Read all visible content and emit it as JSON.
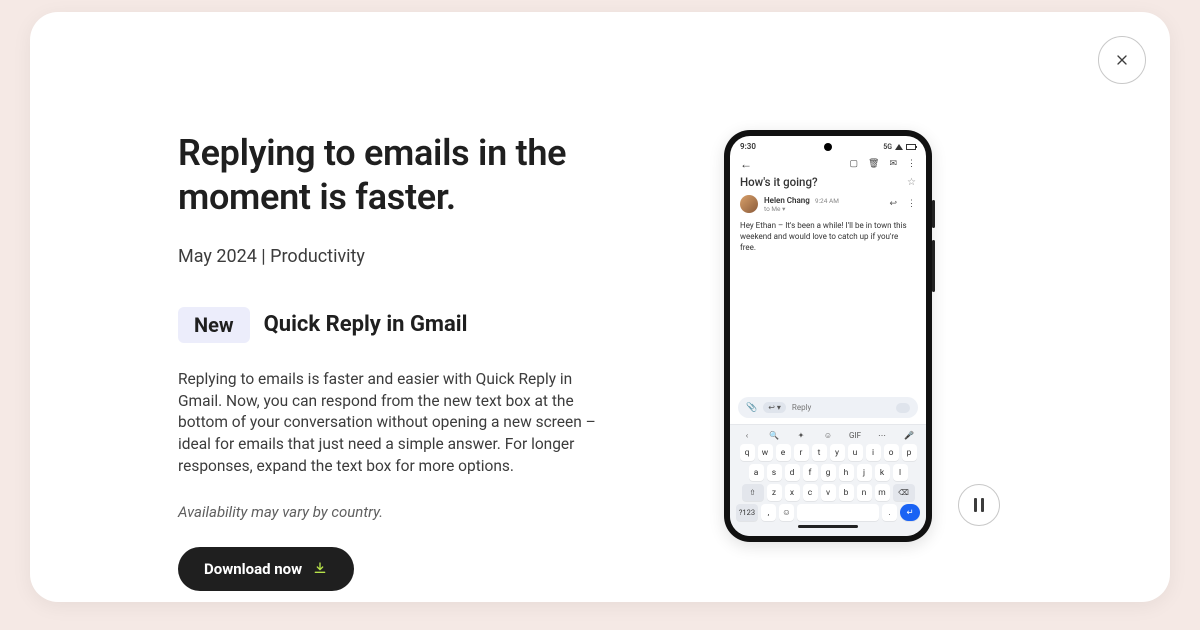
{
  "modal": {
    "headline": "Replying to emails in the moment is faster.",
    "meta": "May 2024 | Productivity",
    "badge": "New",
    "feature_name": "Quick Reply in Gmail",
    "description": "Replying to emails is faster and easier with Quick Reply in Gmail. Now, you can respond from the new text box at the bottom of your conversation without opening a new screen – ideal for emails that just need a simple answer. For longer responses, expand the text box for more options.",
    "availability_note": "Availability may vary by country.",
    "cta_label": "Download now"
  },
  "phone": {
    "status_time": "9:30",
    "status_network": "5G",
    "email": {
      "subject": "How's it going?",
      "sender_name": "Helen Chang",
      "sender_time": "9:24 AM",
      "recipient_line": "to Me ▾",
      "body": "Hey Ethan – It's been a while! I'll be in town this weekend and would love to catch up if you're free.",
      "reply_placeholder": "Reply"
    },
    "keyboard": {
      "toprow_icons": [
        "‹",
        "🔍",
        "✦",
        "☺",
        "GIF",
        "⋯",
        "🎤"
      ],
      "row1": [
        "q",
        "w",
        "e",
        "r",
        "t",
        "y",
        "u",
        "i",
        "o",
        "p"
      ],
      "row2": [
        "a",
        "s",
        "d",
        "f",
        "g",
        "h",
        "j",
        "k",
        "l"
      ],
      "row3_shift": "⇧",
      "row3": [
        "z",
        "x",
        "c",
        "v",
        "b",
        "n",
        "m"
      ],
      "row3_back": "⌫",
      "bottom_sym": "?123",
      "bottom_comma": ",",
      "bottom_emoji": "☺",
      "bottom_period": ".",
      "bottom_enter": "↵"
    }
  }
}
